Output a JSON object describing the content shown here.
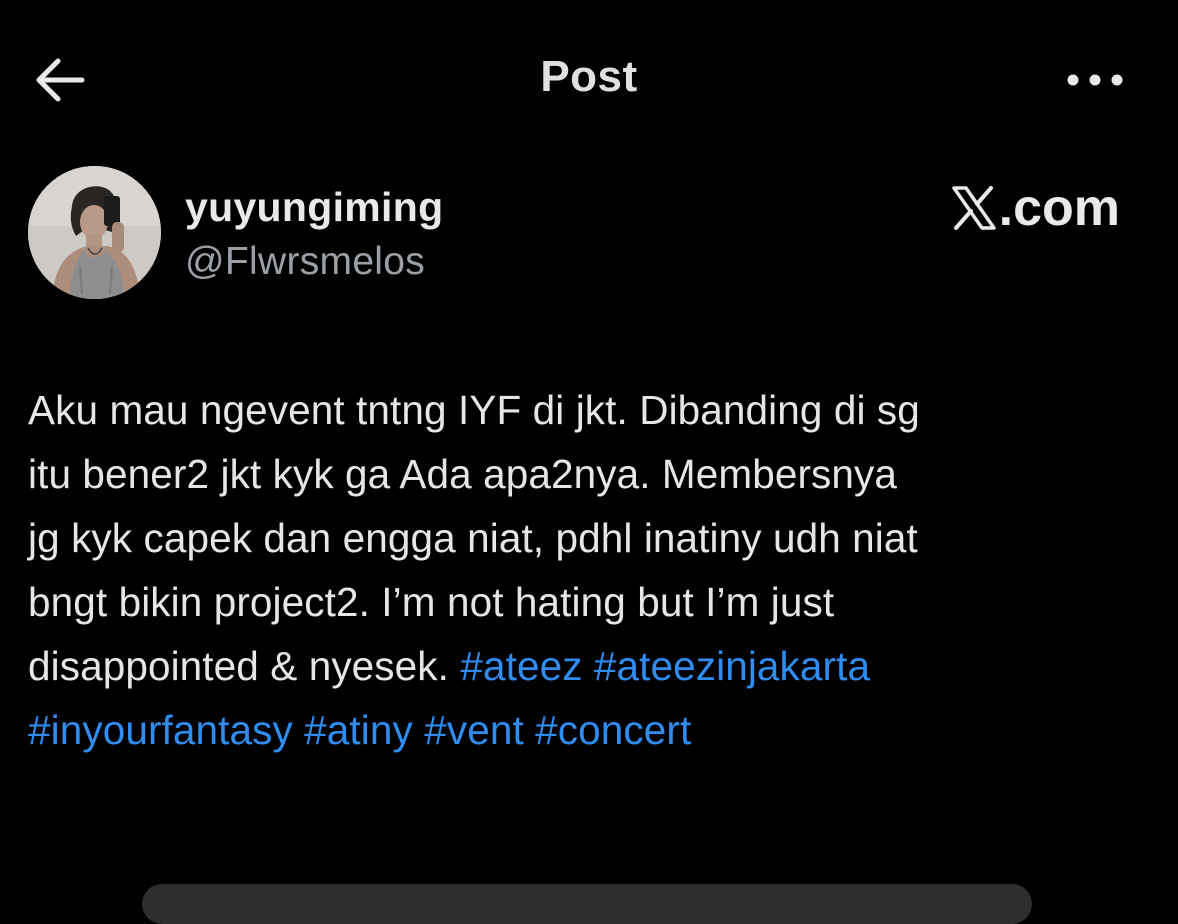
{
  "header": {
    "title": "Post",
    "back_icon": "arrow-left-icon",
    "more_icon": "more-horizontal-icon"
  },
  "author": {
    "display_name": "yuyungiming",
    "handle": "@Flwrsmelos",
    "avatar": "avatar-photo"
  },
  "source": {
    "logo_icon": "x-logo-icon",
    "domain_suffix": ".com"
  },
  "post": {
    "lines": [
      "Aku mau ngevent tntng IYF di jkt. Dibanding di sg",
      "itu bener2 jkt kyk ga Ada apa2nya. Membersnya",
      "jg kyk capek dan engga niat, pdhl inatiny udh niat",
      "bngt bikin project2. I’m not hating but I’m just",
      "disappointed & nyesek."
    ],
    "hashtags": [
      "#ateez",
      "#ateezinjakarta",
      "#inyourfantasy",
      "#atiny",
      "#vent",
      "#concert"
    ]
  },
  "colors": {
    "background": "#000000",
    "text": "#e7e9ea",
    "secondary_text": "#9aa0a6",
    "hashtag": "#2f8cf0"
  }
}
